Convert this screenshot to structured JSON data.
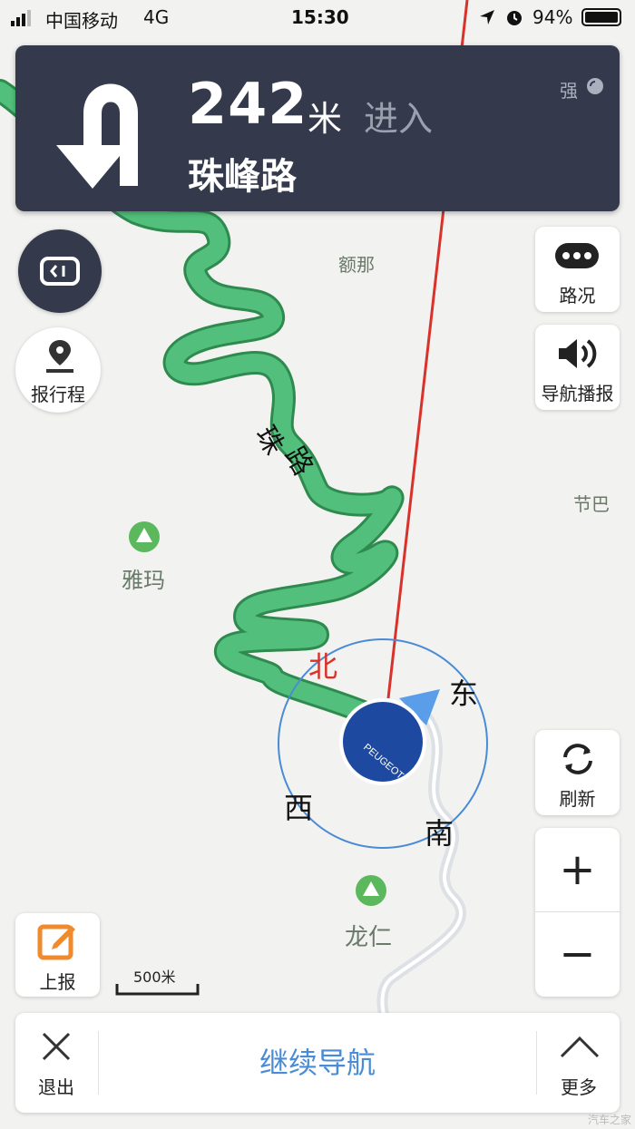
{
  "status_bar": {
    "carrier": "中国移动",
    "network": "4G",
    "time": "15:30",
    "battery": "94%"
  },
  "nav_banner": {
    "distance": "242",
    "distance_unit": "米",
    "action": "进入",
    "road": "珠峰路",
    "gps_strength": "强",
    "turn_icon": "u-turn-icon"
  },
  "map": {
    "place_labels": [
      "额那",
      "节巴",
      "雅玛",
      "龙仁"
    ],
    "road_label_1": "珠",
    "road_label_2": "路",
    "compass": {
      "north": "北",
      "east": "东",
      "south": "南",
      "west": "西"
    },
    "car_logo": "PEUGEOT",
    "scale": "500米",
    "watermark": "汽车之家"
  },
  "buttons": {
    "report_trip": "报行程",
    "traffic": "路况",
    "voice": "导航播报",
    "refresh": "刷新",
    "zoom_in": "+",
    "zoom_out": "−",
    "report": "上报",
    "exit": "退出",
    "continue_nav": "继续导航",
    "more": "更多"
  },
  "colors": {
    "route": "#52c07c",
    "banner": "#343a4c",
    "accent": "#4a8bd6",
    "north": "#d9322b",
    "report_orange": "#f08a2c"
  }
}
